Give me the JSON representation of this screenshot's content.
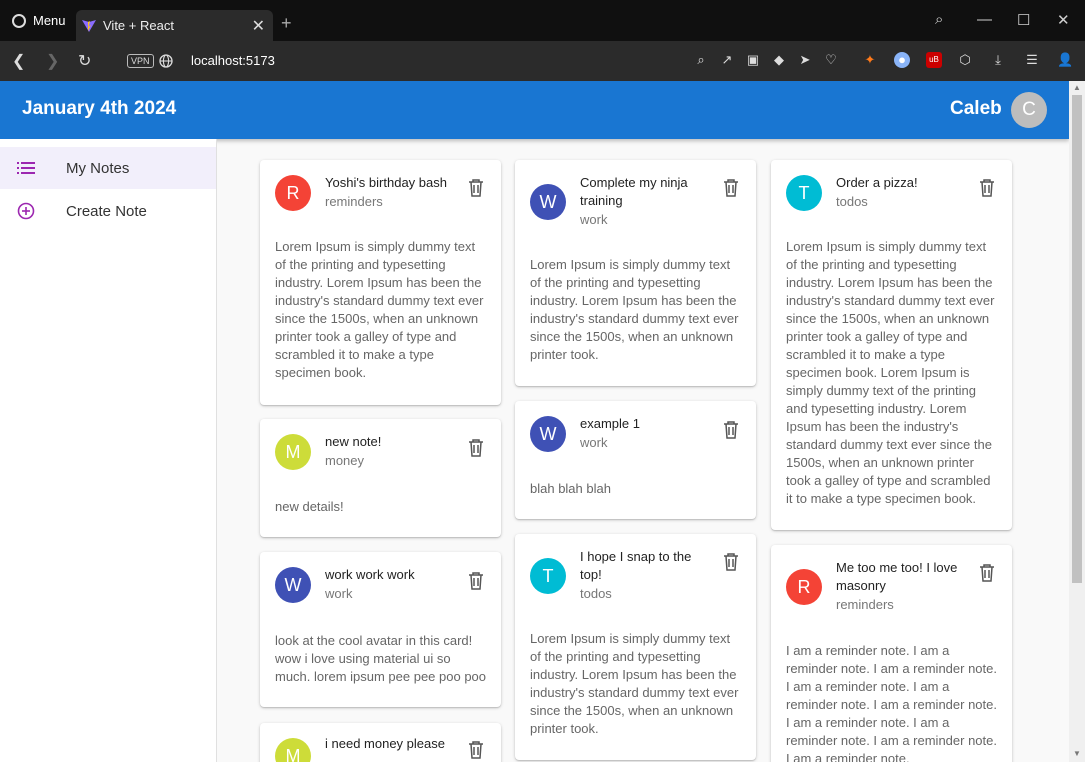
{
  "browser": {
    "menu_label": "Menu",
    "tab_title": "Vite + React",
    "vpn_label": "VPN",
    "url": "localhost:5173"
  },
  "app": {
    "date": "January 4th 2024",
    "username": "Caleb",
    "avatar_initial": "C",
    "accent_color": "#1976d2"
  },
  "drawer": {
    "items": [
      {
        "label": "My Notes",
        "icon": "list-icon",
        "active": true
      },
      {
        "label": "Create Note",
        "icon": "add-circle-icon",
        "active": false
      }
    ]
  },
  "notes": [
    {
      "initial": "R",
      "title": "Yoshi's birthday bash",
      "category": "reminders",
      "color": "#f44336",
      "body": "Lorem Ipsum is simply dummy text of the printing and typesetting industry. Lorem Ipsum has been the industry's standard dummy text ever since the 1500s, when an unknown printer took a galley of type and scrambled it to make a type specimen book."
    },
    {
      "initial": "W",
      "title": "Complete my ninja training",
      "category": "work",
      "color": "#3f51b5",
      "body": "Lorem Ipsum is simply dummy text of the printing and typesetting industry. Lorem Ipsum has been the industry's standard dummy text ever since the 1500s, when an unknown printer took."
    },
    {
      "initial": "T",
      "title": "Order a pizza!",
      "category": "todos",
      "color": "#00bcd4",
      "body": "Lorem Ipsum is simply dummy text of the printing and typesetting industry. Lorem Ipsum has been the industry's standard dummy text ever since the 1500s, when an unknown printer took a galley of type and scrambled it to make a type specimen book. Lorem Ipsum is simply dummy text of the printing and typesetting industry. Lorem Ipsum has been the industry's standard dummy text ever since the 1500s, when an unknown printer took a galley of type and scrambled it to make a type specimen book."
    },
    {
      "initial": "M",
      "title": "new note!",
      "category": "money",
      "color": "#cddc39",
      "body": "new details!"
    },
    {
      "initial": "W",
      "title": "example 1",
      "category": "work",
      "color": "#3f51b5",
      "body": "blah blah blah"
    },
    {
      "initial": "W",
      "title": "work work work",
      "category": "work",
      "color": "#3f51b5",
      "body": "look at the cool avatar in this card! wow i love using material ui so much. lorem ipsum pee pee poo poo"
    },
    {
      "initial": "T",
      "title": "I hope I snap to the top!",
      "category": "todos",
      "color": "#00bcd4",
      "body": "Lorem Ipsum is simply dummy text of the printing and typesetting industry. Lorem Ipsum has been the industry's standard dummy text ever since the 1500s, when an unknown printer took."
    },
    {
      "initial": "R",
      "title": "Me too me too! I love masonry",
      "category": "reminders",
      "color": "#f44336",
      "body": "I am a reminder note. I am a reminder note. I am a reminder note. I am a reminder note. I am a reminder note. I am a reminder note. I am a reminder note. I am a reminder note. I am a reminder note. I am a reminder note."
    },
    {
      "initial": "M",
      "title": "i need money please",
      "category": "",
      "color": "#cddc39",
      "body": ""
    }
  ]
}
